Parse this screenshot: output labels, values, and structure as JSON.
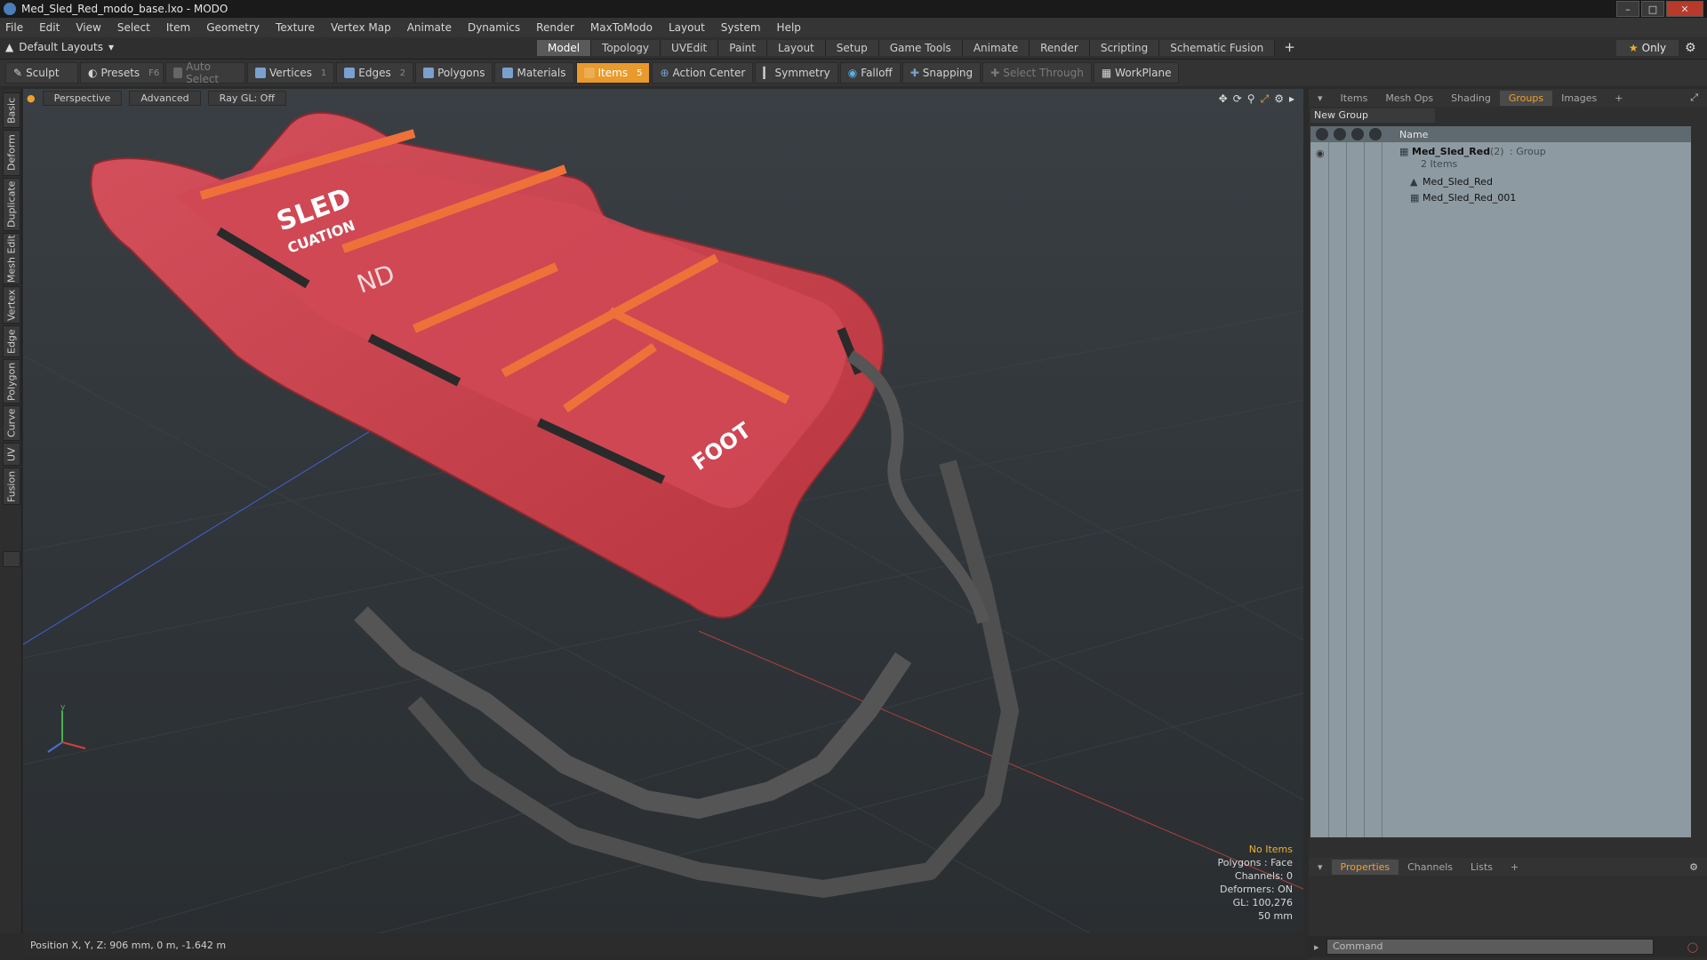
{
  "window": {
    "title": "Med_Sled_Red_modo_base.lxo - MODO"
  },
  "menu": [
    "File",
    "Edit",
    "View",
    "Select",
    "Item",
    "Geometry",
    "Texture",
    "Vertex Map",
    "Animate",
    "Dynamics",
    "Render",
    "MaxToModo",
    "Layout",
    "System",
    "Help"
  ],
  "layout": {
    "selector": "Default Layouts",
    "tabs": [
      "Model",
      "Topology",
      "UVEdit",
      "Paint",
      "Layout",
      "Setup",
      "Game Tools",
      "Animate",
      "Render",
      "Scripting",
      "Schematic Fusion"
    ],
    "active_tab": "Model",
    "only_label": "Only"
  },
  "toolbar": {
    "sculpt": "Sculpt",
    "presets": "Presets",
    "presets_key": "F6",
    "auto_select": "Auto Select",
    "vertices": "Vertices",
    "vertices_count": "1",
    "edges": "Edges",
    "edges_count": "2",
    "polygons": "Polygons",
    "materials": "Materials",
    "items": "Items",
    "items_count": "5",
    "action_center": "Action Center",
    "symmetry": "Symmetry",
    "falloff": "Falloff",
    "snapping": "Snapping",
    "select_through": "Select Through",
    "workplane": "WorkPlane"
  },
  "left_tabs": [
    "Basic",
    "Deform",
    "Duplicate",
    "Mesh Edit",
    "Vertex",
    "Edge",
    "Polygon",
    "Curve",
    "UV",
    "Fusion"
  ],
  "viewport": {
    "view": "Perspective",
    "shading": "Advanced",
    "raygl": "Ray GL: Off",
    "stats": {
      "items": "No Items",
      "polygons": "Polygons : Face",
      "channels": "Channels: 0",
      "deformers": "Deformers: ON",
      "gl": "GL: 100,276",
      "scale": "50 mm"
    },
    "sled_text": {
      "sled": "SLED",
      "evac": "CUATION",
      "foot": "FOOT",
      "nd": "ND"
    }
  },
  "status": {
    "position": "Position X, Y, Z:  906 mm, 0 m, -1.642 m"
  },
  "right_panel": {
    "tabs": [
      "Items",
      "Mesh Ops",
      "Shading",
      "Groups",
      "Images"
    ],
    "active_tab": "Groups",
    "new_group": "New Group",
    "name_header": "Name",
    "group": {
      "name": "Med_Sled_Red",
      "count": "(2)",
      "type": ": Group",
      "items_label": "2 Items"
    },
    "children": [
      "Med_Sled_Red",
      "Med_Sled_Red_001"
    ],
    "bottom_tabs": [
      "Properties",
      "Channels",
      "Lists"
    ],
    "bottom_active": "Properties",
    "command_placeholder": "Command"
  },
  "colors": {
    "accent": "#e89a2b",
    "sled": "#c9404e",
    "strap": "#f0703a"
  }
}
